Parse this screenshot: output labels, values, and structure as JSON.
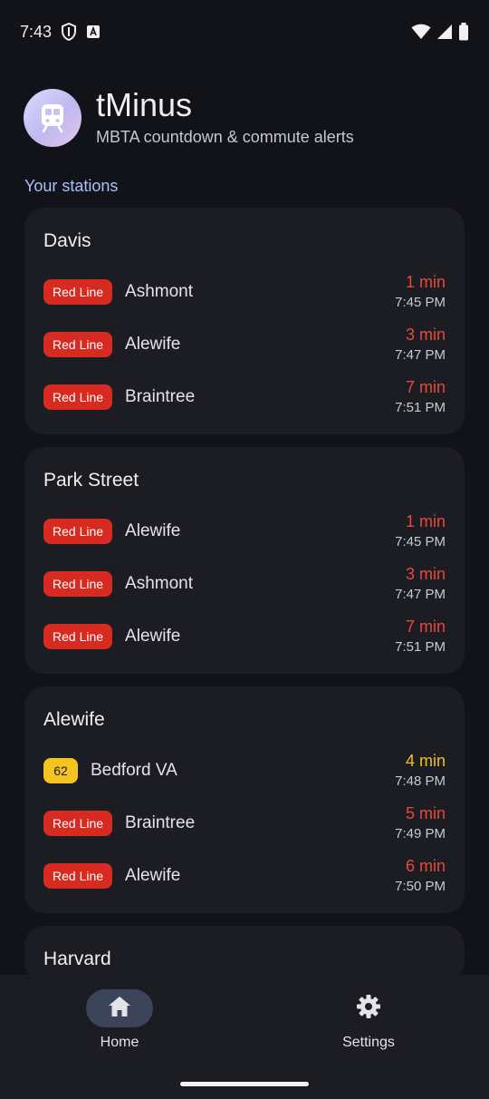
{
  "status_bar": {
    "time": "7:43",
    "icons": [
      "shield-icon",
      "a-box-icon",
      "wifi-icon",
      "signal-icon",
      "battery-icon"
    ]
  },
  "app": {
    "title": "tMinus",
    "subtitle": "MBTA countdown & commute alerts",
    "logo_icon": "train-icon"
  },
  "section_label": "Your stations",
  "colors": {
    "red_line": "#d72b22",
    "bus": "#f4c520",
    "accent": "#a8c0ff",
    "background": "#121318",
    "card": "#1c1d23"
  },
  "stations": [
    {
      "name": "Davis",
      "departures": [
        {
          "route": "Red Line",
          "route_type": "red",
          "destination": "Ashmont",
          "eta": "1 min",
          "time": "7:45 PM"
        },
        {
          "route": "Red Line",
          "route_type": "red",
          "destination": "Alewife",
          "eta": "3 min",
          "time": "7:47 PM"
        },
        {
          "route": "Red Line",
          "route_type": "red",
          "destination": "Braintree",
          "eta": "7 min",
          "time": "7:51 PM"
        }
      ]
    },
    {
      "name": "Park Street",
      "departures": [
        {
          "route": "Red Line",
          "route_type": "red",
          "destination": "Alewife",
          "eta": "1 min",
          "time": "7:45 PM"
        },
        {
          "route": "Red Line",
          "route_type": "red",
          "destination": "Ashmont",
          "eta": "3 min",
          "time": "7:47 PM"
        },
        {
          "route": "Red Line",
          "route_type": "red",
          "destination": "Alewife",
          "eta": "7 min",
          "time": "7:51 PM"
        }
      ]
    },
    {
      "name": "Alewife",
      "departures": [
        {
          "route": "62",
          "route_type": "yellow",
          "destination": "Bedford VA",
          "eta": "4 min",
          "time": "7:48 PM"
        },
        {
          "route": "Red Line",
          "route_type": "red",
          "destination": "Braintree",
          "eta": "5 min",
          "time": "7:49 PM"
        },
        {
          "route": "Red Line",
          "route_type": "red",
          "destination": "Alewife",
          "eta": "6 min",
          "time": "7:50 PM"
        }
      ]
    },
    {
      "name": "Harvard",
      "departures": []
    }
  ],
  "nav": {
    "home_label": "Home",
    "settings_label": "Settings",
    "active": "home"
  }
}
